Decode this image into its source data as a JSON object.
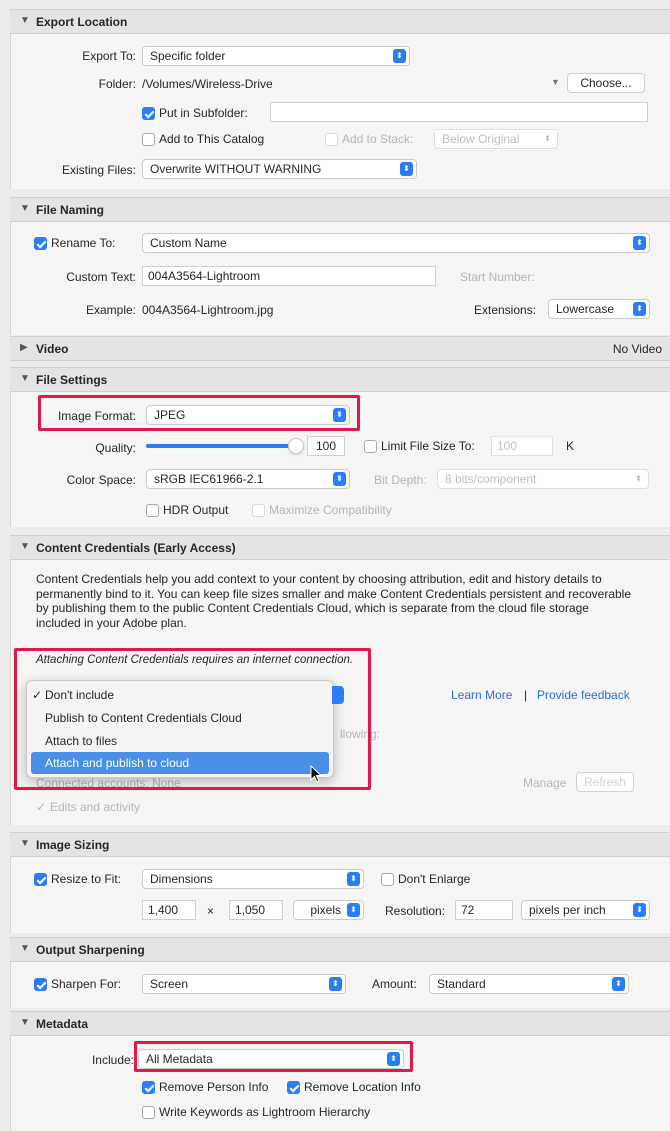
{
  "export_location": {
    "title": "Export Location",
    "export_to_label": "Export To:",
    "export_to_value": "Specific folder",
    "folder_label": "Folder:",
    "folder_value": "/Volumes/Wireless-Drive",
    "choose_button": "Choose...",
    "put_in_subfolder_label": "Put in Subfolder:",
    "put_in_subfolder_checked": true,
    "subfolder_value": "",
    "add_to_catalog_label": "Add to This Catalog",
    "add_to_stack_label": "Add to Stack:",
    "stack_position_value": "Below Original",
    "existing_files_label": "Existing Files:",
    "existing_files_value": "Overwrite WITHOUT WARNING"
  },
  "file_naming": {
    "title": "File Naming",
    "rename_to_label": "Rename To:",
    "rename_to_value": "Custom Name",
    "custom_text_label": "Custom Text:",
    "custom_text_value": "004A3564-Lightroom",
    "start_number_label": "Start Number:",
    "example_label": "Example:",
    "example_value": "004A3564-Lightroom.jpg",
    "extensions_label": "Extensions:",
    "extensions_value": "Lowercase"
  },
  "video": {
    "title": "Video",
    "status": "No Video"
  },
  "file_settings": {
    "title": "File Settings",
    "image_format_label": "Image Format:",
    "image_format_value": "JPEG",
    "quality_label": "Quality:",
    "quality_value": "100",
    "quality_fraction": 1.0,
    "limit_file_size_label": "Limit File Size To:",
    "limit_file_size_value": "100",
    "limit_file_size_unit": "K",
    "color_space_label": "Color Space:",
    "color_space_value": "sRGB IEC61966-2.1",
    "bit_depth_label": "Bit Depth:",
    "bit_depth_value": "8 bits/component",
    "hdr_output_label": "HDR Output",
    "maximize_compat_label": "Maximize Compatibility"
  },
  "content_credentials": {
    "title": "Content Credentials (Early Access)",
    "description": "Content Credentials help you add context to your content by choosing attribution, edit and history details to permanently bind to it. You can keep file sizes smaller and make Content Credentials persistent and recoverable by publishing them to the public Content Credentials Cloud, which is separate from the cloud file storage included in your Adobe plan.",
    "internet_note": "Attaching Content Credentials requires an internet connection.",
    "learn_more": "Learn More",
    "separator": "|",
    "provide_feedback": "Provide feedback",
    "partial_following": "llowing:",
    "connected_accounts": "Connected accounts: None",
    "manage": "Manage",
    "refresh": "Refresh",
    "edits_activity": "Edits and activity",
    "menu": {
      "items": [
        {
          "label": "Don't include",
          "checked": true
        },
        {
          "label": "Publish to Content Credentials Cloud",
          "checked": false
        },
        {
          "label": "Attach to files",
          "checked": false
        },
        {
          "label": "Attach and publish to cloud",
          "checked": false
        }
      ],
      "check_glyph": "✓"
    }
  },
  "image_sizing": {
    "title": "Image Sizing",
    "resize_to_fit_label": "Resize to Fit:",
    "resize_to_fit_value": "Dimensions",
    "dont_enlarge_label": "Don't Enlarge",
    "width_value": "1,400",
    "times": "×",
    "height_value": "1,050",
    "units_value": "pixels",
    "resolution_label": "Resolution:",
    "resolution_value": "72",
    "resolution_units_value": "pixels per inch"
  },
  "output_sharpening": {
    "title": "Output Sharpening",
    "sharpen_for_label": "Sharpen For:",
    "sharpen_for_value": "Screen",
    "amount_label": "Amount:",
    "amount_value": "Standard"
  },
  "metadata": {
    "title": "Metadata",
    "include_label": "Include:",
    "include_value": "All Metadata",
    "remove_person_label": "Remove Person Info",
    "remove_location_label": "Remove Location Info",
    "write_keywords_label": "Write Keywords as Lightroom Hierarchy"
  },
  "glyphs": {
    "expanded": "▼",
    "collapsed": "▶",
    "updown": "⬍"
  },
  "colors": {
    "accent": "#2a7ef5",
    "highlight_box": "#e1184a",
    "link": "#2a6fd8"
  }
}
